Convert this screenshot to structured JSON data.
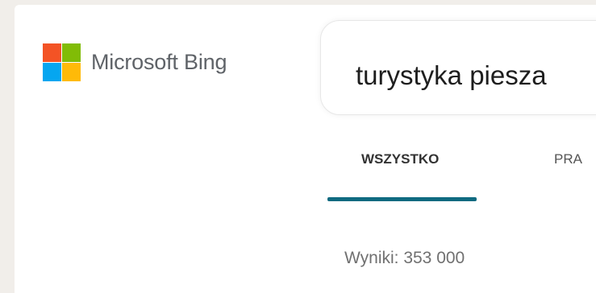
{
  "brand": {
    "name": "Microsoft Bing",
    "colors": {
      "red": "#f35325",
      "green": "#81bc06",
      "blue": "#05a6f0",
      "yellow": "#ffba08"
    }
  },
  "search": {
    "value": "turystyka piesza"
  },
  "tabs": [
    {
      "label": "WSZYSTKO",
      "active": true
    },
    {
      "label": "PRA",
      "active": false
    }
  ],
  "results": {
    "count_text": "Wyniki: 353 000"
  },
  "theme": {
    "accent": "#0f6a80",
    "background": "#f1eeea"
  }
}
